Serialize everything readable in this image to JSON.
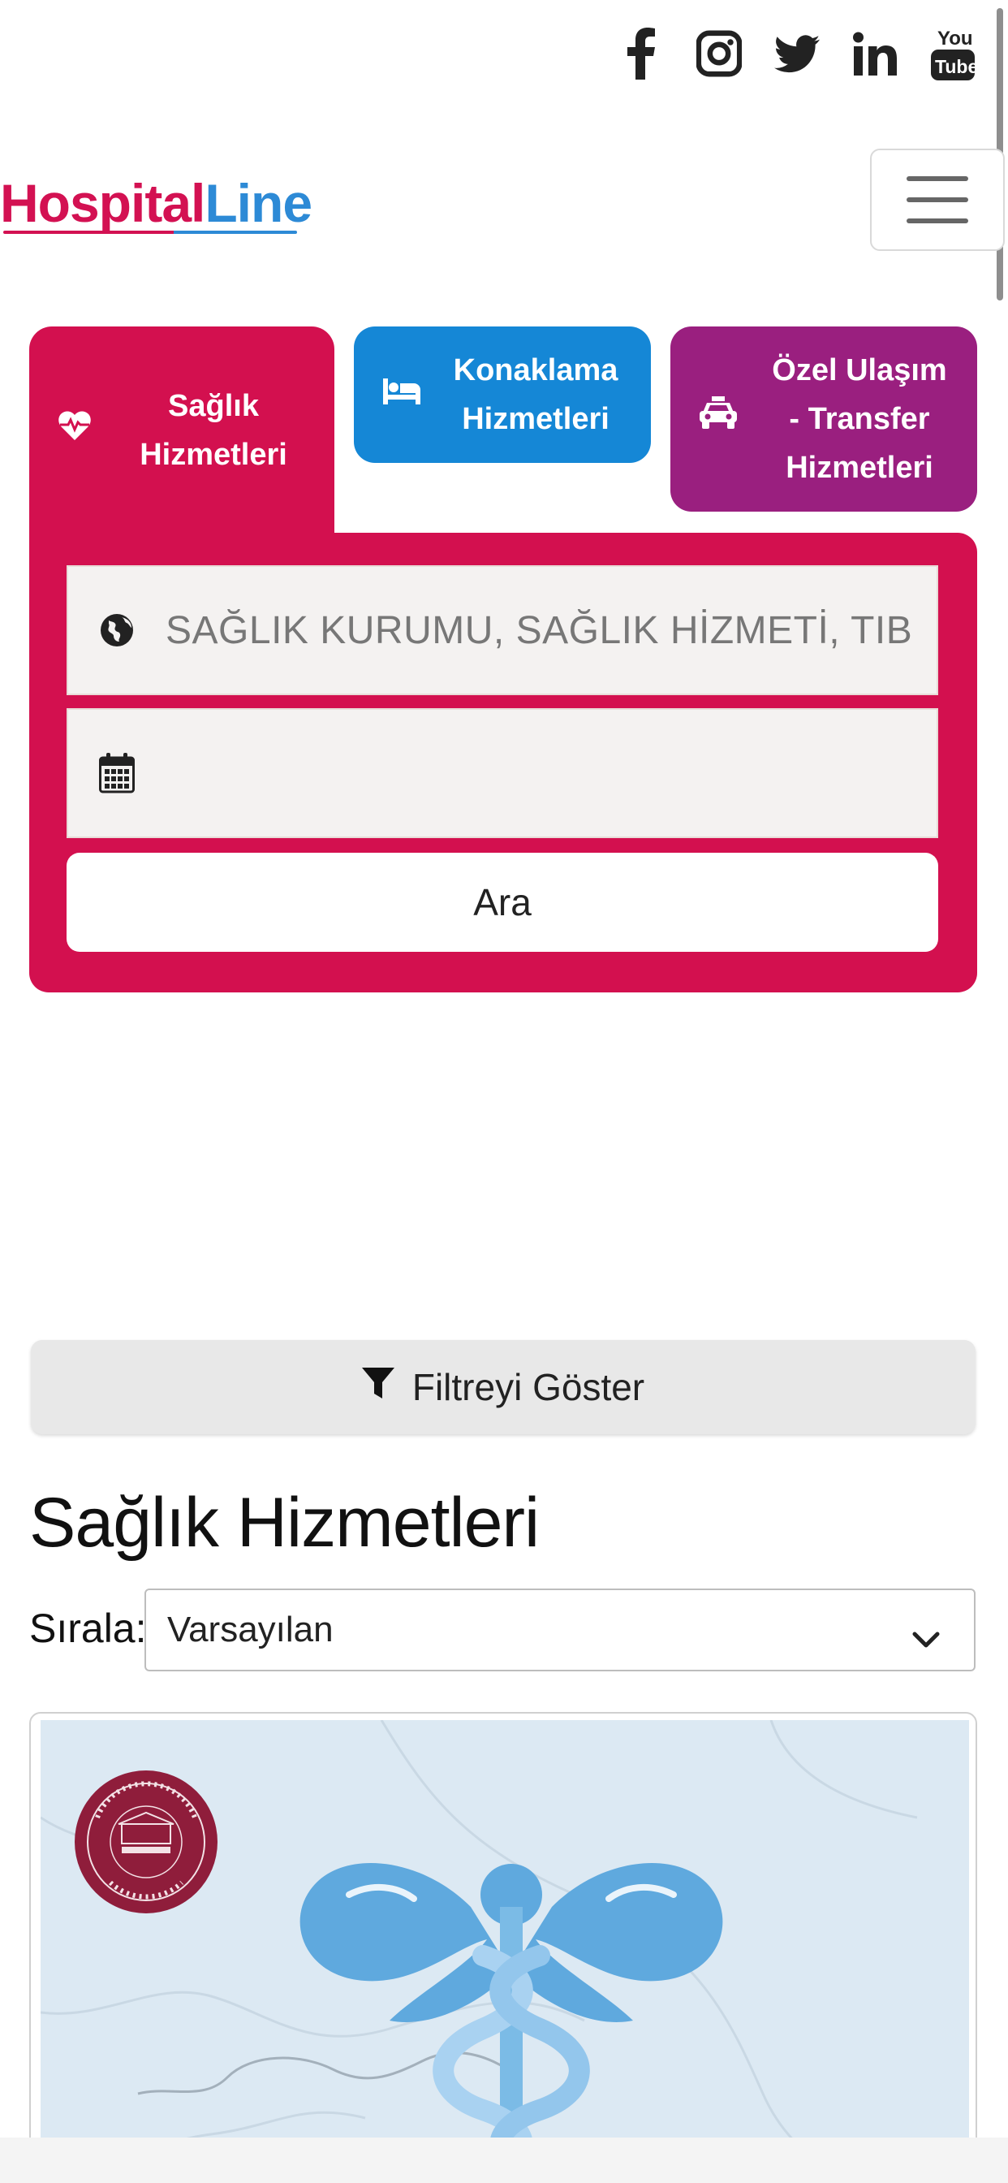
{
  "brand": {
    "name_part1": "Hospital",
    "name_part2": "Line",
    "hosp_color": "#d31152",
    "line_color": "#2d8ad6"
  },
  "social": [
    "facebook-icon",
    "instagram-icon",
    "twitter-icon",
    "linkedin-icon",
    "youtube-icon"
  ],
  "tabs": [
    {
      "label_line1": "Sağlık",
      "label_line2": "Hizmetleri",
      "icon": "heartbeat-icon",
      "color": "#d3104f"
    },
    {
      "label_line1": "Konaklama",
      "label_line2": "Hizmetleri",
      "icon": "bed-icon",
      "color": "#1587d6"
    },
    {
      "label_line1": "Özel Ulaşım",
      "label_line2": "- Transfer",
      "label_line3": "Hizmetleri",
      "icon": "taxi-icon",
      "color": "#9a1f7f"
    }
  ],
  "search": {
    "placeholder": "SAĞLIK KURUMU, SAĞLIK HİZMETİ, TIBBİ BRANŞ",
    "date_value": "",
    "button_label": "Ara"
  },
  "filter": {
    "label": "Filtreyi Göster"
  },
  "section": {
    "title": "Sağlık Hizmetleri"
  },
  "sort": {
    "label": "Sırala:",
    "selected": "Varsayılan"
  },
  "card": {
    "logo_alt_text": "BEZMİALEM VAKIF ÜNİVERSİTESİ HASTANESİ"
  }
}
